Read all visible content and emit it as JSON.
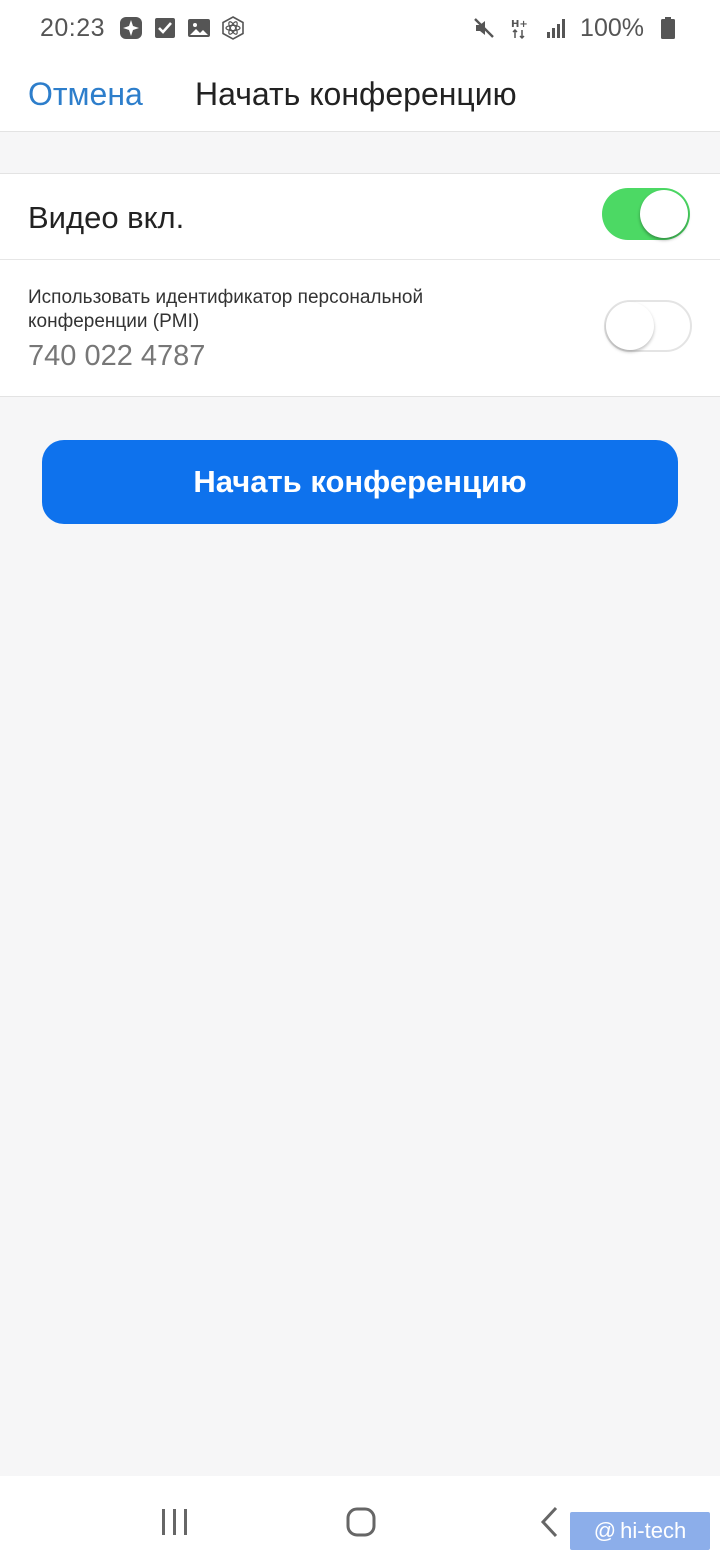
{
  "status_bar": {
    "time": "20:23",
    "battery_text": "100%",
    "left_icons": [
      "app-grid-icon",
      "checkbox-icon",
      "image-icon",
      "atom-icon"
    ],
    "right_icons": [
      "mute-icon",
      "network-hplus-icon",
      "signal-icon",
      "battery-icon"
    ]
  },
  "header": {
    "cancel_label": "Отмена",
    "title": "Начать конференцию"
  },
  "settings": {
    "video": {
      "label": "Видео вкл.",
      "enabled": true
    },
    "pmi": {
      "label": "Использовать идентификатор персональной конференции (PMI)",
      "id_value": "740 022 4787",
      "enabled": false
    }
  },
  "start_button_label": "Начать конференцию",
  "nav_bar": {
    "icons": [
      "recent-apps-icon",
      "home-icon",
      "back-icon"
    ]
  },
  "watermark": {
    "text": "hi-tech"
  },
  "colors": {
    "accent_link": "#2d7ecb",
    "primary_button": "#0e72ed",
    "toggle_on": "#4cd964",
    "background": "#f6f6f7"
  }
}
